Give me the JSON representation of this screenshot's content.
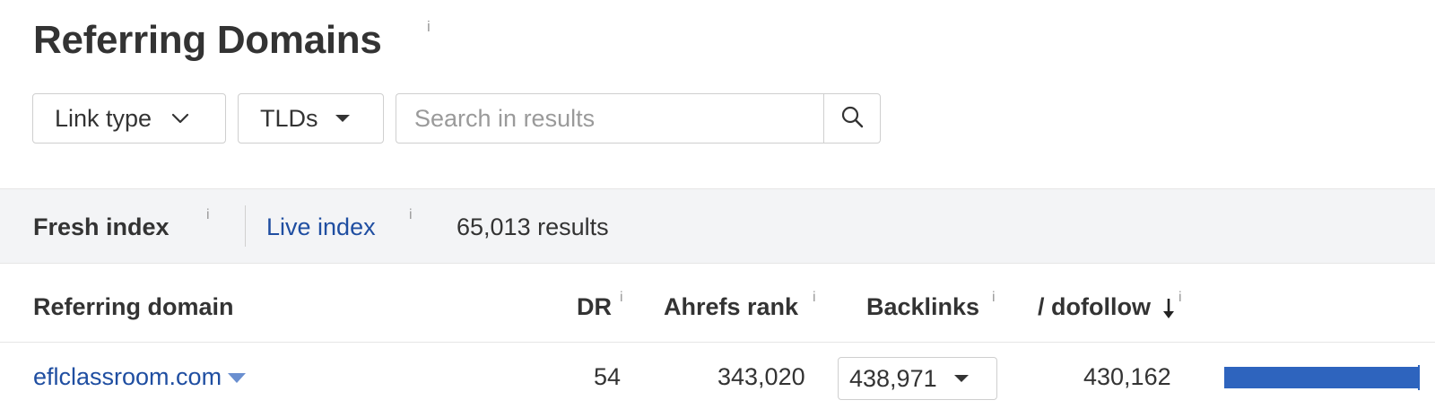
{
  "header": {
    "title": "Referring Domains",
    "title_info": "i"
  },
  "filters": {
    "link_type_label": "Link type",
    "tlds_label": "TLDs",
    "search_placeholder": "Search in results"
  },
  "index_bar": {
    "fresh_label": "Fresh index",
    "fresh_info": "i",
    "live_label": "Live index",
    "live_info": "i",
    "results_text": "65,013 results"
  },
  "table": {
    "columns": {
      "referring_domain": "Referring domain",
      "dr": "DR",
      "dr_info": "i",
      "ahrefs_rank": "Ahrefs rank",
      "ahrefs_rank_info": "i",
      "backlinks": "Backlinks",
      "backlinks_info": "i",
      "dofollow": "/ dofollow",
      "dofollow_info": "i"
    },
    "rows": [
      {
        "domain": "eflclassroom.com",
        "dr": "54",
        "ahrefs_rank": "343,020",
        "backlinks": "438,971",
        "dofollow": "430,162",
        "dofollow_fraction": 0.98
      }
    ]
  },
  "colors": {
    "link": "#1f4ea1",
    "bar": "#2e64be",
    "bar_background": "#f3f4f6"
  },
  "icons": {
    "link_type": "chevron-down-icon",
    "tlds": "caret-down-icon",
    "search": "search-icon",
    "sort": "arrow-down-icon",
    "domain_menu": "triangle-down-icon",
    "backlinks_menu": "caret-down-icon"
  }
}
